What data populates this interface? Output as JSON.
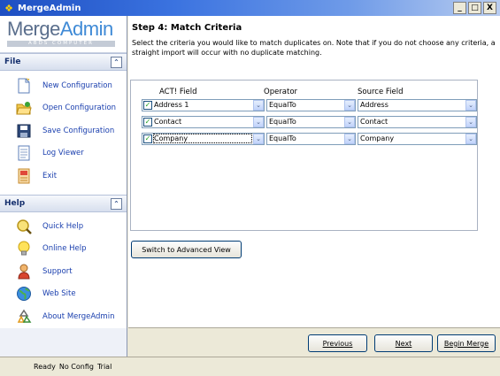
{
  "window": {
    "title": "MergeAdmin",
    "min_label": "_",
    "max_label": "□",
    "close_label": "X"
  },
  "logo": {
    "part1": "Merge",
    "part2": "Admin",
    "subtitle": "ABDS COMPUTER"
  },
  "file_section": {
    "header": "File",
    "collapse_symbol": "⌃",
    "items": [
      {
        "label": "New Configuration",
        "icon": "new-document-icon"
      },
      {
        "label": "Open Configuration",
        "icon": "open-folder-icon"
      },
      {
        "label": "Save Configuration",
        "icon": "floppy-disk-icon"
      },
      {
        "label": "Log Viewer",
        "icon": "log-document-icon"
      },
      {
        "label": "Exit",
        "icon": "exit-icon"
      }
    ]
  },
  "help_section": {
    "header": "Help",
    "collapse_symbol": "⌃",
    "items": [
      {
        "label": "Quick Help",
        "icon": "magnifier-icon"
      },
      {
        "label": "Online Help",
        "icon": "lightbulb-icon"
      },
      {
        "label": "Support",
        "icon": "support-person-icon"
      },
      {
        "label": "Web Site",
        "icon": "globe-icon"
      },
      {
        "label": "About MergeAdmin",
        "icon": "recycle-icon"
      }
    ]
  },
  "step": {
    "title": "Step 4: Match Criteria",
    "description": "Select the criteria you would like to match duplicates on. Note that if you do not choose any criteria, a straight import will occur with no duplicate matching."
  },
  "criteria": {
    "headers": {
      "act_field": "ACT! Field",
      "operator": "Operator",
      "source_field": "Source Field"
    },
    "rows": [
      {
        "act_field": "Address 1",
        "operator": "EqualTo",
        "source_field": "Address",
        "checked": true
      },
      {
        "act_field": "Contact",
        "operator": "EqualTo",
        "source_field": "Contact",
        "checked": true
      },
      {
        "act_field": "Company",
        "operator": "EqualTo",
        "source_field": "Company",
        "checked": true
      }
    ],
    "check_mark": "✓",
    "dropdown_symbol": "⌄"
  },
  "buttons": {
    "advanced": "Switch to Advanced View",
    "previous": "Previous",
    "next": "Next",
    "begin_merge": "Begin Merge"
  },
  "status": {
    "ready": "Ready",
    "config": "No Config",
    "license": "Trial"
  },
  "colors": {
    "title_bar": "#1e4fc2",
    "link": "#1a3fae",
    "section_header_text": "#16306e"
  }
}
